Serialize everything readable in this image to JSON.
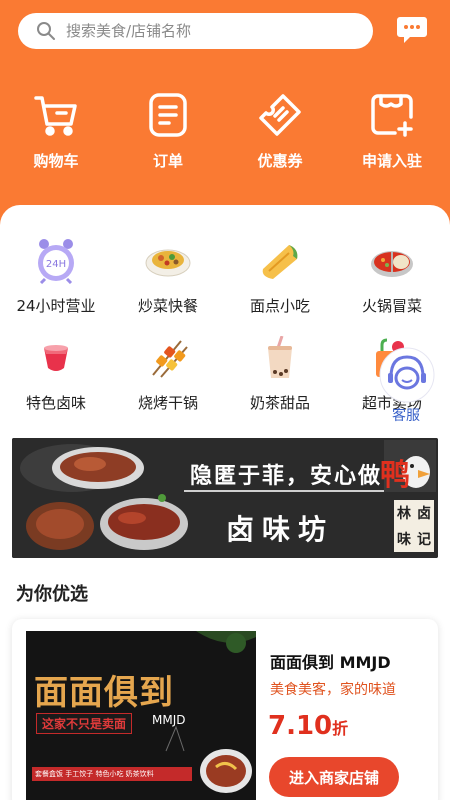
{
  "search": {
    "placeholder": "搜索美食/店铺名称",
    "icon": "search-icon"
  },
  "header": {
    "bg_color": "#fa7a33",
    "message_icon": "message-icon",
    "quick_actions": [
      {
        "label": "购物车",
        "icon": "cart-icon"
      },
      {
        "label": "订单",
        "icon": "order-icon"
      },
      {
        "label": "优惠券",
        "icon": "coupon-icon"
      },
      {
        "label": "申请入驻",
        "icon": "apply-icon"
      }
    ]
  },
  "categories": [
    {
      "label": "24小时营业",
      "icon": "alarm-clock-icon"
    },
    {
      "label": "炒菜快餐",
      "icon": "fried-dish-icon"
    },
    {
      "label": "面点小吃",
      "icon": "pastry-icon"
    },
    {
      "label": "火锅冒菜",
      "icon": "hotpot-icon"
    },
    {
      "label": "特色卤味",
      "icon": "braised-icon"
    },
    {
      "label": "烧烤干锅",
      "icon": "skewer-icon"
    },
    {
      "label": "奶茶甜品",
      "icon": "milk-tea-icon"
    },
    {
      "label": "超市卖场",
      "icon": "supermarket-icon"
    }
  ],
  "customer_service": {
    "label": "客服",
    "icon": "customer-service-icon"
  },
  "banner": {
    "slogan": "隐匿于菲，安心做",
    "slogan_highlight": "鸭",
    "shop_name": "卤味坊",
    "stamp": [
      "林",
      "卤",
      "味",
      "记"
    ]
  },
  "section": {
    "title": "为你优选"
  },
  "recommend": {
    "name": "面面俱到 MMJD",
    "desc": "美食美客，家的味道",
    "discount": "7.10",
    "discount_unit": "折",
    "button": "进入商家店铺",
    "image": {
      "headline": "面面俱到",
      "tagline": "这家不只是卖面",
      "brand": "MMJD",
      "tags": "套餐盒饭  手工饺子  特色小吃  奶茶饮料"
    }
  }
}
